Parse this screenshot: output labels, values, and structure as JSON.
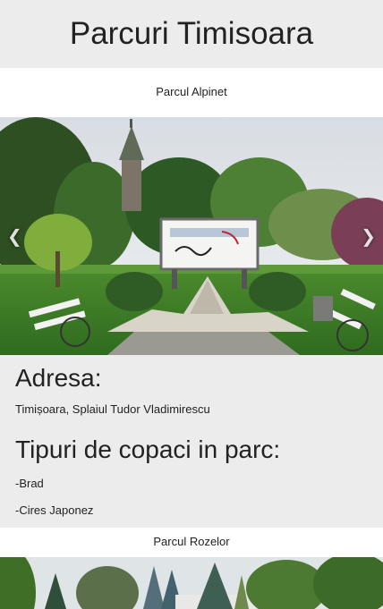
{
  "header": {
    "title": "Parcuri Timisoara"
  },
  "parks": [
    {
      "name": "Parcul Alpinet",
      "address_heading": "Adresa:",
      "address": "Timișoara, Splaiul Tudor Vladimirescu",
      "trees_heading": "Tipuri de copaci in parc:",
      "trees": [
        "-Brad",
        "-Cires Japonez"
      ]
    },
    {
      "name": "Parcul Rozelor"
    }
  ],
  "carousel": {
    "prev_icon": "chevron-left-icon",
    "next_icon": "chevron-right-icon"
  },
  "colors": {
    "header_bg": "#ececec",
    "info_bg": "#ececec"
  }
}
